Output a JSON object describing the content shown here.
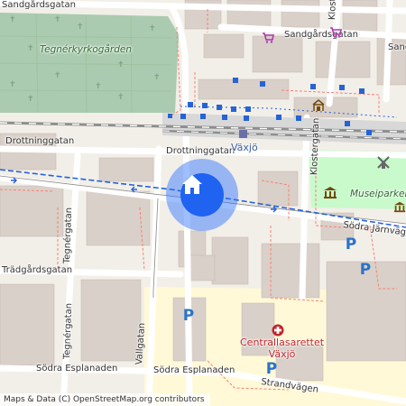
{
  "map": {
    "labels": {
      "sandgardsgatan_nw": "Sandgårdsgatan",
      "sandgardsgatan_ne": "Sandgårdsgatan",
      "sandgardsgatan_e": "Sandgå",
      "kyrkogard": "Tegnérkyrkogården",
      "drottninggatan_w": "Drottninggatan",
      "drottninggatan_e": "Drottninggatan",
      "vaxjo_station": "Växjö",
      "klostergatan_top": "Klosterg",
      "klostergatan": "Klostergatan",
      "museiparken": "Museiparken",
      "sodra_jarnvagsgatan": "Södra Järnvägsg",
      "tegnergatan_n": "Tegnérgatan",
      "tegnergatan_s": "Tegnérgatan",
      "tradgardsgatan": "Trädgårdsgatan",
      "vallgatan": "Vallgatan",
      "sodra_esplanaden_w": "Södra Esplanaden",
      "sodra_esplanaden_e": "Södra Esplanaden",
      "strandvagen": "Strandvägen",
      "hospital_line1": "Centrallasarettet",
      "hospital_line2": "Växjö",
      "parking_symbol": "P"
    },
    "icons": [
      "shop-icon",
      "station-icon",
      "museum-icon",
      "windmill-icon",
      "parking-icon",
      "hospital-icon",
      "home-icon"
    ],
    "colors": {
      "land": "#f2efe9",
      "park": "#c8facc",
      "cemetery": "#aacbaf",
      "building": "#d9d0c9",
      "hospital_area": "#fff9d8",
      "railway": "#8e8e8e",
      "bus_route": "#2563d6",
      "footway": "#fa8072",
      "location": "#1f63f0",
      "hospital": "#c0272d",
      "parking": "#2b72c9"
    }
  },
  "attribution": "Maps & Data (C) OpenStreetMap.org contributors"
}
